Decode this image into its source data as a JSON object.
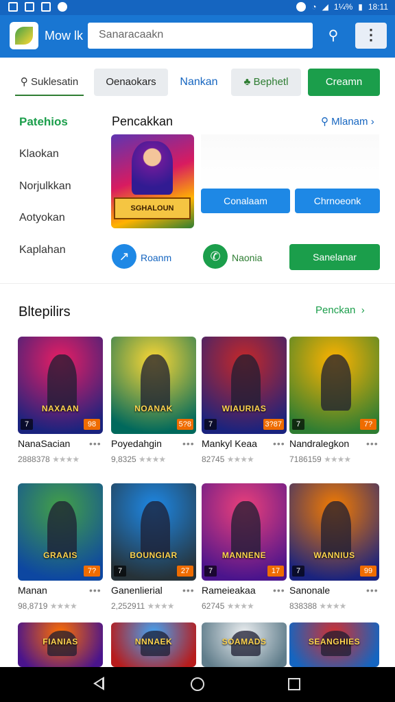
{
  "status_bar": {
    "battery": "1¼%",
    "time": "18:11"
  },
  "app_bar": {
    "title": "Mow lk",
    "search_placeholder": "Sanaracaakn",
    "search_icon": "search-icon",
    "menu_icon": "⋮"
  },
  "chips": [
    {
      "label": "Suklesatin",
      "icon": "search-icon"
    },
    {
      "label": "Oenaokars"
    },
    {
      "label": "Nankan"
    },
    {
      "label": "Bephetl",
      "icon": "leaf-icon"
    },
    {
      "label": "Creamn"
    }
  ],
  "side_nav": {
    "active": "Patehios",
    "items": [
      "Klaokan",
      "Norjulkkan",
      "Aotyokan",
      "Kaplahan"
    ]
  },
  "featured": {
    "title": "Pencakkan",
    "see_all": "Mlanam",
    "art_text": "SGHALOUN",
    "buttons": [
      "Conalaam",
      "Chrnoeonk"
    ],
    "actions": [
      {
        "label": "Roanm",
        "icon": "trend-icon"
      },
      {
        "label": "Naonia",
        "icon": "phone-icon"
      }
    ],
    "primary_button": "Sanelanar"
  },
  "games_section": {
    "title": "Bltepilirs",
    "see_all": "Penckan"
  },
  "games": [
    {
      "name": "NanaSacian",
      "rating": "2888378",
      "art": "NAXAAN",
      "l": "7",
      "r": "98",
      "c1": "#e91e63",
      "c2": "#1a237e"
    },
    {
      "name": "Poyedahgin",
      "rating": "9,8325",
      "art": "NOANAK",
      "l": "",
      "r": "5?8",
      "c1": "#fdd835",
      "c2": "#00695c"
    },
    {
      "name": "Mankyl Keaa",
      "rating": "82745",
      "art": "WIAURIAS",
      "l": "7",
      "r": "3?87",
      "c1": "#c62828",
      "c2": "#1a237e"
    },
    {
      "name": "Nandralegkon",
      "rating": "7186159",
      "art": "",
      "l": "7",
      "r": "7?",
      "c1": "#ffb300",
      "c2": "#2e7d32"
    },
    {
      "name": "Manan",
      "rating": "98,8719",
      "art": "GRAAIS",
      "l": "",
      "r": "7?",
      "c1": "#43a047",
      "c2": "#0d47a1"
    },
    {
      "name": "Ganenlierial",
      "rating": "2,252911",
      "art": "BOUNGIAR",
      "l": "7",
      "r": "27",
      "c1": "#1e88e5",
      "c2": "#263238"
    },
    {
      "name": "Rameieakaa",
      "rating": "62745",
      "art": "MANNENE",
      "l": "7",
      "r": "17",
      "c1": "#ec407a",
      "c2": "#4a148c"
    },
    {
      "name": "Sanonale",
      "rating": "838388",
      "art": "WANNIUS",
      "l": "7",
      "r": "99",
      "c1": "#f57c00",
      "c2": "#1a237e"
    },
    {
      "name": "",
      "rating": "",
      "art": "FIANIAS",
      "l": "",
      "r": "",
      "c1": "#ff6f00",
      "c2": "#4a148c"
    },
    {
      "name": "",
      "rating": "",
      "art": "NNNAEK",
      "l": "",
      "r": "",
      "c1": "#42a5f5",
      "c2": "#b71c1c"
    },
    {
      "name": "",
      "rating": "",
      "art": "SOAMADS",
      "l": "",
      "r": "",
      "c1": "#eceff1",
      "c2": "#607d8b"
    },
    {
      "name": "",
      "rating": "",
      "art": "SEANGHIES",
      "l": "",
      "r": "",
      "c1": "#d32f2f",
      "c2": "#1565c0"
    }
  ],
  "stars": "★★★★"
}
